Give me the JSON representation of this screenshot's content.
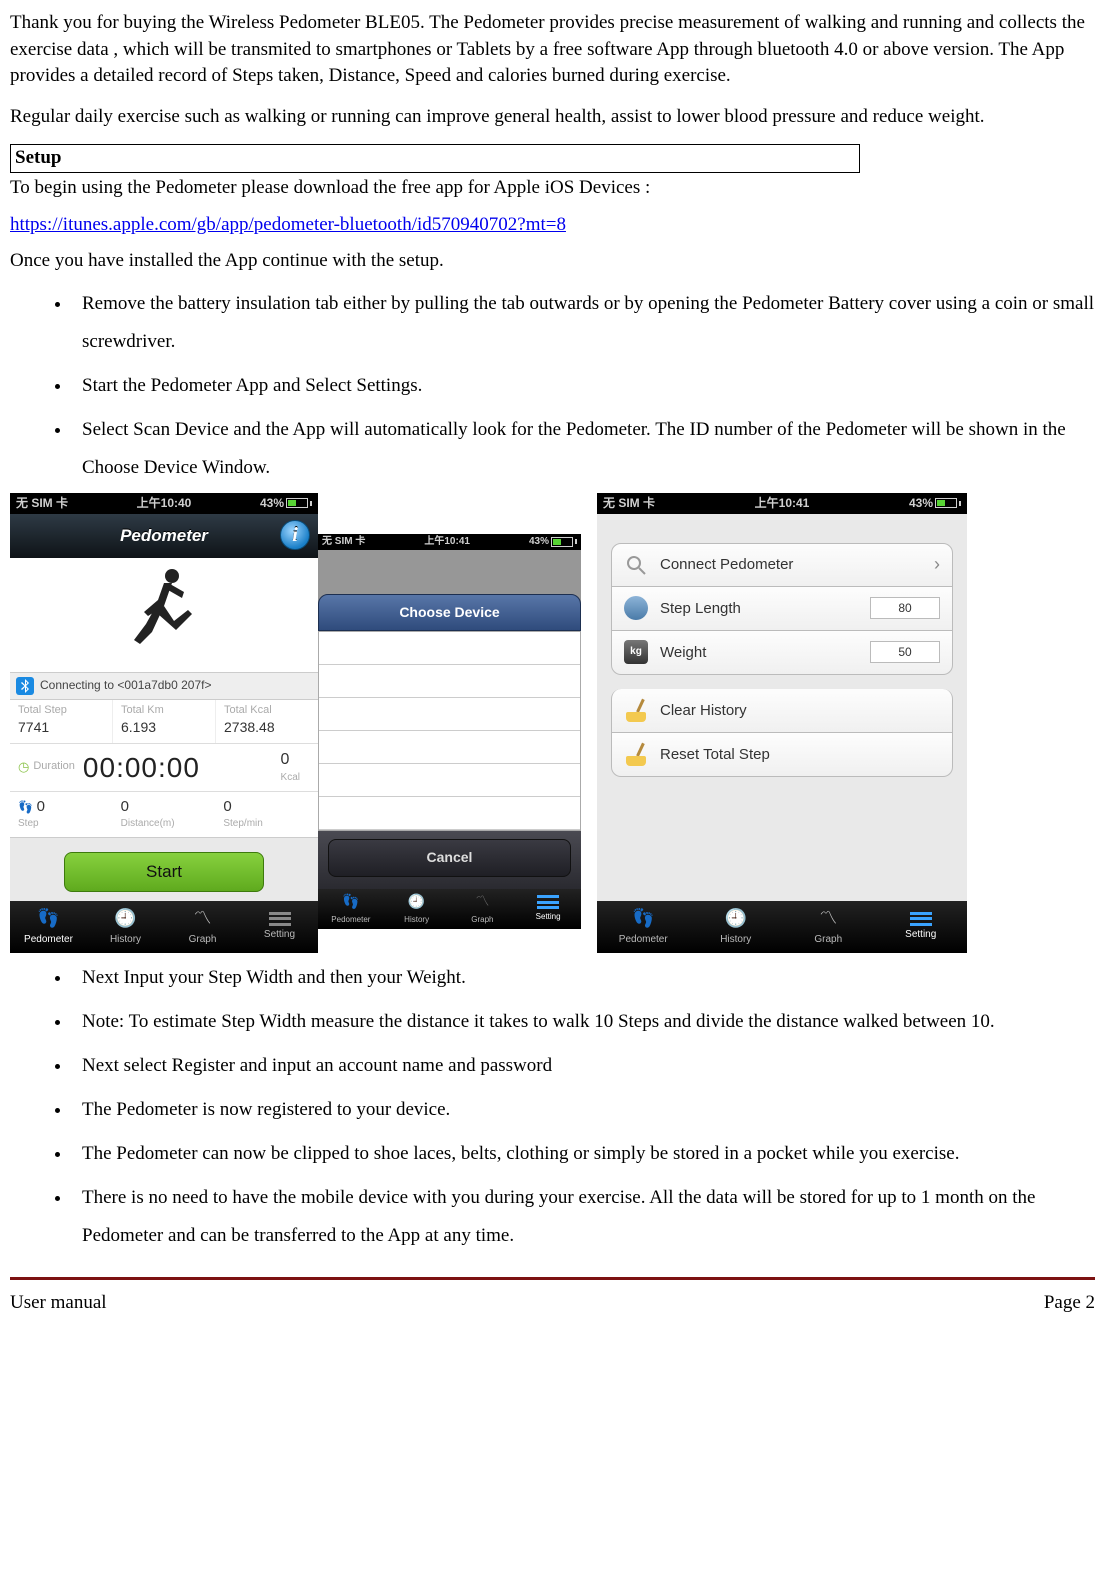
{
  "intro": {
    "p1": "Thank you for buying the  Wireless Pedometer BLE05. The Pedometer provides precise measurement of walking and running and collects the exercise data , which will be transmited to smartphones or Tablets by a free software App through bluetooth 4.0 or above version. The App provides a detailed record of Steps taken, Distance, Speed and calories burned during exercise.",
    "p2": "Regular daily exercise such as walking or running can improve general health, assist to lower blood pressure and reduce weight."
  },
  "setup": {
    "heading": "Setup",
    "line1": "To begin using the Pedometer please download the free app for Apple iOS Devices :",
    "link_text": "https://itunes.apple.com/gb/app/pedometer-bluetooth/id570940702?mt=8",
    "line2": "Once you have installed the App continue with the setup.",
    "bullets_top": [
      "Remove the battery insulation tab either by pulling the tab outwards or by opening the Pedometer Battery cover using a coin or small screwdriver.",
      "Start the Pedometer App and Select Settings.",
      "Select Scan Device and the App will automatically look for the Pedometer. The ID number of the Pedometer will be shown in the Choose Device Window."
    ],
    "bullets_bottom": [
      "Next Input your Step Width and then your Weight.",
      "Note: To estimate Step Width measure the distance it takes to walk 10 Steps and divide the distance walked between 10.",
      "Next select Register and input an account name and password",
      "The Pedometer is now registered to your device.",
      "The Pedometer can now be clipped to shoe laces, belts, clothing or simply be stored in a pocket while you exercise.",
      "There is no need to have the mobile device with you during your exercise. All the data will be stored for up to 1 month on the Pedometer and can be transferred to the App at any time."
    ]
  },
  "screenshots": {
    "status": {
      "carrier": "无 SIM 卡",
      "time_a": "上午10:40",
      "time_b": "上午10:41",
      "time_c": "上午10:41",
      "battery": "43%"
    },
    "main": {
      "title": "Pedometer",
      "info_icon": "i",
      "connecting": "Connecting to <001a7db0 207f>",
      "totals": {
        "step_label": "Total Step",
        "step_value": "7741",
        "km_label": "Total Km",
        "km_value": "6.193",
        "kcal_label": "Total Kcal",
        "kcal_value": "2738.48"
      },
      "duration": {
        "label": "Duration",
        "time": "00:00:00",
        "kcal_v": "0",
        "kcal_l": "Kcal"
      },
      "row3": {
        "a_v": "0",
        "a_l": "Step",
        "b_v": "0",
        "b_l": "Distance(m)",
        "c_v": "0",
        "c_l": "Step/min"
      },
      "start": "Start"
    },
    "modal": {
      "title": "Choose Device",
      "cancel": "Cancel"
    },
    "settings": {
      "connect": "Connect Pedometer",
      "step_length": "Step Length",
      "step_length_val": "80",
      "weight": "Weight",
      "weight_val": "50",
      "clear": "Clear History",
      "reset": "Reset Total Step"
    },
    "tabs": {
      "a": "Pedometer",
      "b": "History",
      "c": "Graph",
      "d": "Setting"
    }
  },
  "footer": {
    "left": "User manual",
    "right": "Page 2"
  }
}
